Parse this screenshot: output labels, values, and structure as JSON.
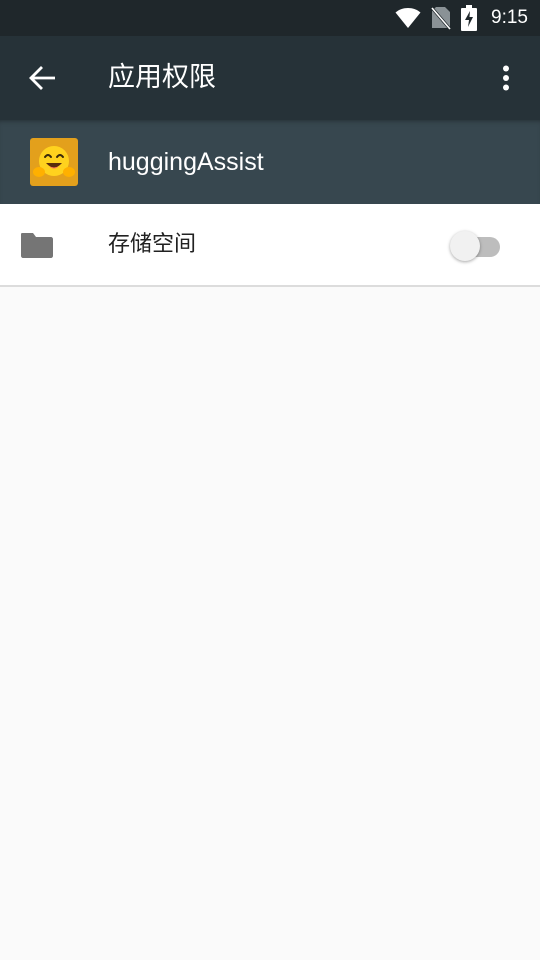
{
  "status_bar": {
    "time": "9:15",
    "icons": [
      "wifi-icon",
      "no-sim-icon",
      "battery-charging-icon"
    ]
  },
  "app_bar": {
    "title": "应用权限",
    "back_icon": "arrow-back-icon",
    "menu_icon": "more-vert-icon"
  },
  "app_header": {
    "app_name": "huggingAssist",
    "app_icon": "hugging-face-emoji-icon"
  },
  "permissions": [
    {
      "label": "存储空间",
      "icon": "folder-icon",
      "enabled": false
    }
  ],
  "colors": {
    "status_bar": "#1f272b",
    "app_bar": "#263238",
    "app_header": "#37474f",
    "background": "#fafafa"
  }
}
